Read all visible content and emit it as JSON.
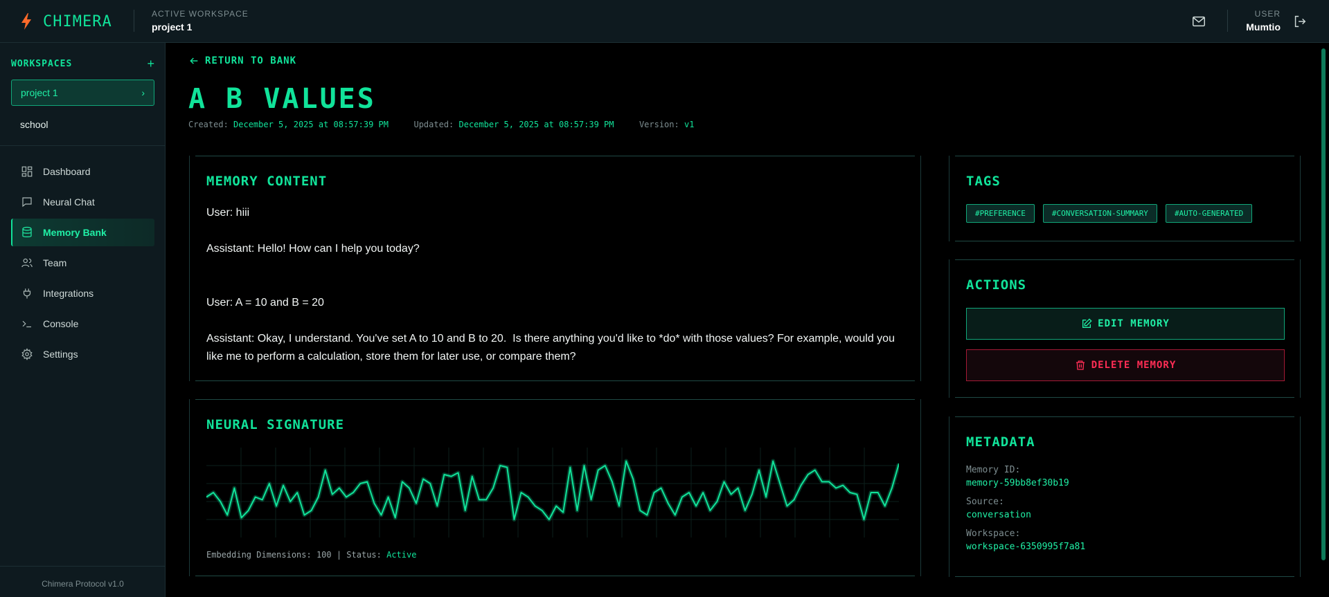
{
  "brand": {
    "name": "CHIMERA"
  },
  "header": {
    "workspace_label": "ACTIVE WORKSPACE",
    "workspace_name": "project 1",
    "user_label": "USER",
    "user_name": "Mumtio"
  },
  "sidebar": {
    "workspaces_title": "WORKSPACES",
    "workspaces": [
      {
        "label": "project 1",
        "active": true
      },
      {
        "label": "school",
        "active": false
      }
    ],
    "nav": [
      {
        "label": "Dashboard",
        "icon": "dashboard-icon"
      },
      {
        "label": "Neural Chat",
        "icon": "chat-icon"
      },
      {
        "label": "Memory Bank",
        "icon": "database-icon",
        "active": true
      },
      {
        "label": "Team",
        "icon": "users-icon"
      },
      {
        "label": "Integrations",
        "icon": "plug-icon"
      },
      {
        "label": "Console",
        "icon": "terminal-icon"
      },
      {
        "label": "Settings",
        "icon": "gear-icon"
      }
    ],
    "footer": "Chimera Protocol v1.0"
  },
  "page": {
    "back_label": "RETURN TO BANK",
    "title": "A B VALUES",
    "created_label": "Created:",
    "created": "December 5, 2025 at 08:57:39 PM",
    "updated_label": "Updated:",
    "updated": "December 5, 2025 at 08:57:39 PM",
    "version_label": "Version:",
    "version": "v1"
  },
  "memory": {
    "title": "MEMORY CONTENT",
    "lines": [
      "User: hiii",
      "Assistant: Hello! How can I help you today?",
      "User: A = 10 and B = 20",
      "Assistant: Okay, I understand. You've set A to 10 and B to 20.  Is there anything you'd like to *do* with those values? For example, would you like me to perform a calculation, store them for later use, or compare them?"
    ]
  },
  "signature": {
    "title": "NEURAL SIGNATURE",
    "footer_prefix": "Embedding Dimensions: 100 | Status:",
    "status": "Active",
    "accent": "#11e39a"
  },
  "chart_data": {
    "type": "line",
    "title": "",
    "values": [
      0.45,
      0.5,
      0.4,
      0.25,
      0.55,
      0.22,
      0.3,
      0.45,
      0.42,
      0.6,
      0.35,
      0.58,
      0.4,
      0.5,
      0.25,
      0.3,
      0.45,
      0.75,
      0.48,
      0.55,
      0.45,
      0.5,
      0.6,
      0.62,
      0.38,
      0.25,
      0.45,
      0.22,
      0.62,
      0.55,
      0.38,
      0.65,
      0.6,
      0.35,
      0.7,
      0.68,
      0.72,
      0.3,
      0.68,
      0.42,
      0.42,
      0.55,
      0.8,
      0.78,
      0.2,
      0.5,
      0.45,
      0.35,
      0.3,
      0.2,
      0.35,
      0.28,
      0.78,
      0.3,
      0.8,
      0.42,
      0.75,
      0.8,
      0.62,
      0.35,
      0.85,
      0.65,
      0.3,
      0.25,
      0.5,
      0.55,
      0.38,
      0.25,
      0.45,
      0.5,
      0.35,
      0.5,
      0.3,
      0.4,
      0.62,
      0.48,
      0.55,
      0.3,
      0.48,
      0.75,
      0.45,
      0.85,
      0.6,
      0.35,
      0.42,
      0.58,
      0.7,
      0.75,
      0.62,
      0.62,
      0.55,
      0.58,
      0.5,
      0.48,
      0.2,
      0.5,
      0.5,
      0.35,
      0.55,
      0.82
    ],
    "ylim": [
      0,
      1
    ]
  },
  "tags": {
    "title": "TAGS",
    "items": [
      "#PREFERENCE",
      "#CONVERSATION-SUMMARY",
      "#AUTO-GENERATED"
    ]
  },
  "actions": {
    "title": "ACTIONS",
    "edit_label": "EDIT MEMORY",
    "delete_label": "DELETE MEMORY"
  },
  "metadata": {
    "title": "METADATA",
    "items": [
      {
        "key": "Memory ID:",
        "value": "memory-59bb8ef30b19"
      },
      {
        "key": "Source:",
        "value": "conversation"
      },
      {
        "key": "Workspace:",
        "value": "workspace-6350995f7a81"
      }
    ]
  }
}
